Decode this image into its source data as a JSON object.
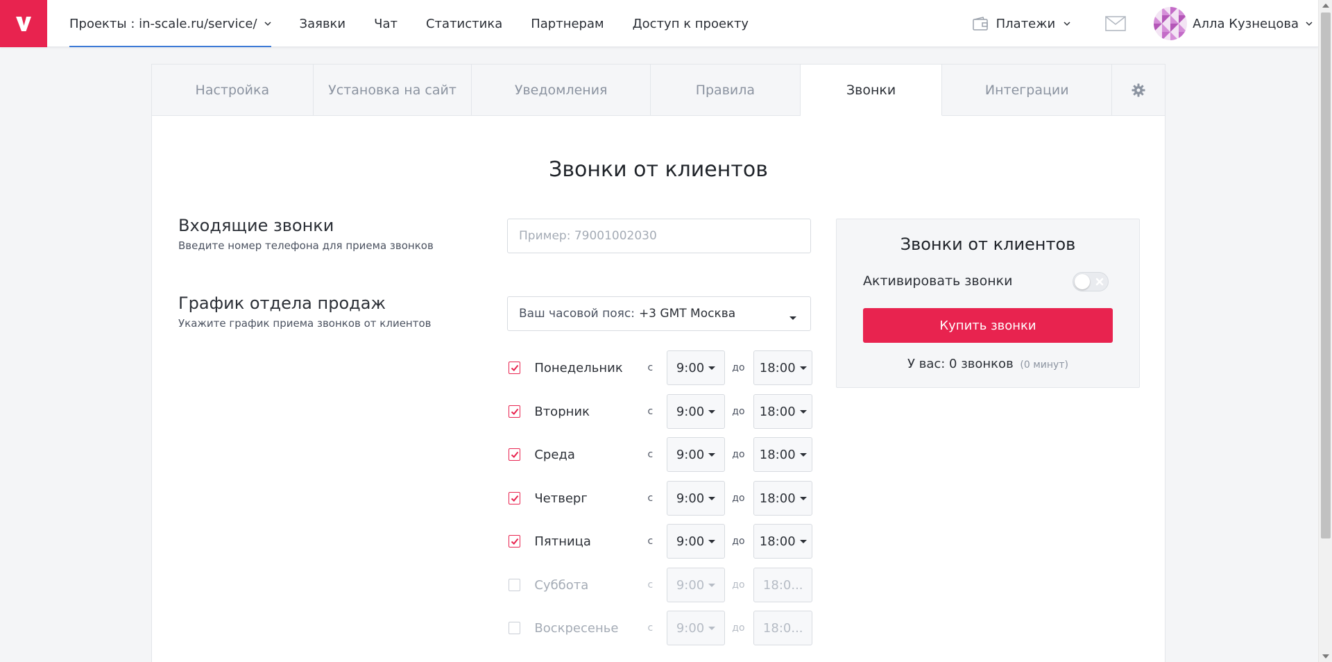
{
  "brand": {
    "accent": "#e8234f",
    "link": "#3d7ad6"
  },
  "nav": {
    "items": [
      {
        "label": "Проекты : in-scale.ru/service/",
        "active": true,
        "dropdown": true
      },
      {
        "label": "Заявки"
      },
      {
        "label": "Чат"
      },
      {
        "label": "Статистика"
      },
      {
        "label": "Партнерам"
      },
      {
        "label": "Доступ к проекту"
      }
    ],
    "payments_label": "Платежи",
    "user_name": "Алла Кузнецова"
  },
  "tabs": [
    {
      "label": "Настройка"
    },
    {
      "label": "Установка на сайт"
    },
    {
      "label": "Уведомления"
    },
    {
      "label": "Правила"
    },
    {
      "label": "Звонки",
      "active": true
    },
    {
      "label": "Интеграции"
    }
  ],
  "page_title": "Звонки от клиентов",
  "incoming": {
    "heading": "Входящие звонки",
    "subtitle": "Введите номер телефона для приема звонков",
    "placeholder": "Пример: 79001002030",
    "value": ""
  },
  "schedule": {
    "heading": "График отдела продаж",
    "subtitle": "Укажите график приема звонков от клиентов",
    "timezone_label": "Ваш часовой пояс:",
    "timezone_value": "+3 GMT Москва",
    "from_label": "с",
    "to_label": "до",
    "days": [
      {
        "name": "Понедельник",
        "checked": true,
        "from": "9:00",
        "to": "18:00"
      },
      {
        "name": "Вторник",
        "checked": true,
        "from": "9:00",
        "to": "18:00"
      },
      {
        "name": "Среда",
        "checked": true,
        "from": "9:00",
        "to": "18:00"
      },
      {
        "name": "Четверг",
        "checked": true,
        "from": "9:00",
        "to": "18:00"
      },
      {
        "name": "Пятница",
        "checked": true,
        "from": "9:00",
        "to": "18:00"
      },
      {
        "name": "Суббота",
        "checked": false,
        "from": "9:00",
        "to": "18:0..."
      },
      {
        "name": "Воскресенье",
        "checked": false,
        "from": "9:00",
        "to": "18:0..."
      }
    ]
  },
  "panel": {
    "title": "Звонки от клиентов",
    "activate_label": "Активировать звонки",
    "activate_on": false,
    "buy_label": "Купить звонки",
    "balance_text": "У вас: 0 звонков",
    "balance_minutes": "(0 минут)"
  }
}
